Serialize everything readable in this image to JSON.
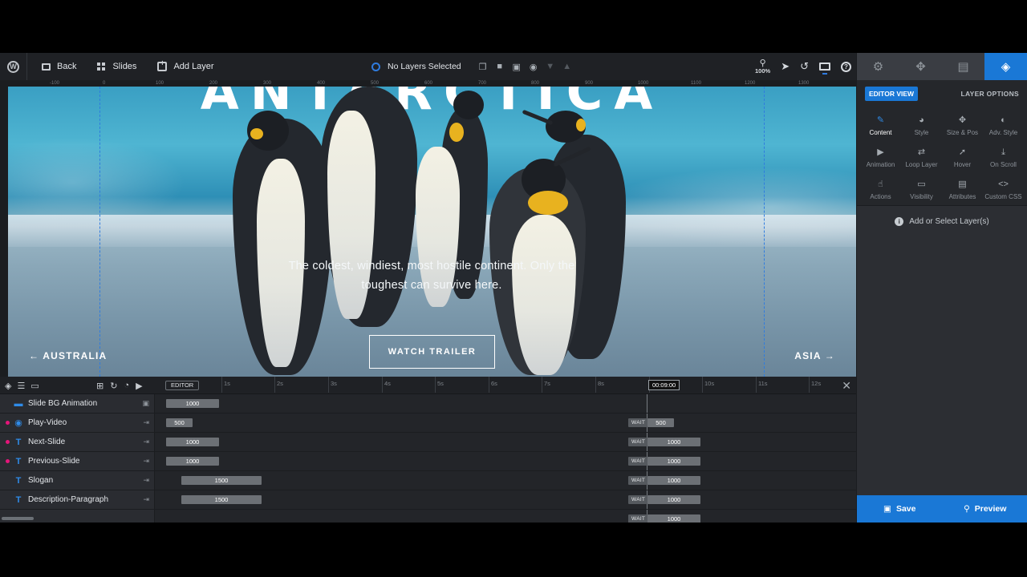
{
  "toolbar": {
    "back_label": "Back",
    "slides_label": "Slides",
    "add_layer_label": "Add Layer",
    "layer_status": "No Layers Selected",
    "zoom_level": "100%"
  },
  "ruler": {
    "marks": [
      "-100",
      "0",
      "100",
      "200",
      "300",
      "400",
      "500",
      "600",
      "700",
      "800",
      "900",
      "1000",
      "1100",
      "1200",
      "1300"
    ]
  },
  "slide": {
    "title": "ANTARCTICA",
    "paragraph": "The coldest, windiest, most hostile continent. Only the toughest can survive here.",
    "button_label": "WATCH TRAILER",
    "prev_label": "← AUSTRALIA",
    "next_label": "ASIA →"
  },
  "panel": {
    "tabs": [
      "gear-icon",
      "puzzle-icon",
      "slides-icon",
      "layers-icon"
    ],
    "editor_view_label": "EDITOR VIEW",
    "layer_options_label": "LAYER OPTIONS",
    "options": [
      {
        "label": "Content",
        "icon": "pencil-icon",
        "active": true
      },
      {
        "label": "Style",
        "icon": "palette-icon"
      },
      {
        "label": "Size & Pos",
        "icon": "move-icon"
      },
      {
        "label": "Adv. Style",
        "icon": "contrast-icon"
      },
      {
        "label": "Animation",
        "icon": "play-icon"
      },
      {
        "label": "Loop Layer",
        "icon": "loop-icon"
      },
      {
        "label": "Hover",
        "icon": "pointer-icon"
      },
      {
        "label": "On Scroll",
        "icon": "scroll-icon"
      },
      {
        "label": "Actions",
        "icon": "hand-icon"
      },
      {
        "label": "Visibility",
        "icon": "visibility-icon"
      },
      {
        "label": "Attributes",
        "icon": "file-icon"
      },
      {
        "label": "Custom CSS",
        "icon": "code-icon"
      }
    ],
    "empty_message": "Add or Select Layer(s)",
    "save_label": "Save",
    "preview_label": "Preview"
  },
  "timeline": {
    "editor_label": "EDITOR",
    "ticks": [
      "1s",
      "2s",
      "3s",
      "4s",
      "5s",
      "6s",
      "7s",
      "8s",
      "9s",
      "10s",
      "11s",
      "12s"
    ],
    "current_time": "00:09:00",
    "wait_label": "WAIT",
    "rows": [
      {
        "name": "Slide BG Animation",
        "type": "slide",
        "start": 1000
      },
      {
        "name": "Play-Video",
        "type": "video",
        "dot": true,
        "start": 500,
        "end": 500
      },
      {
        "name": "Next-Slide",
        "type": "text",
        "dot": true,
        "start": 1000,
        "end": 1000
      },
      {
        "name": "Previous-Slide",
        "type": "text",
        "dot": true,
        "start": 1000,
        "end": 1000
      },
      {
        "name": "Slogan",
        "type": "text",
        "start": 1500,
        "end": 1000
      },
      {
        "name": "Description-Paragraph",
        "type": "text",
        "start": 1500,
        "end": 1000
      },
      {
        "name": "",
        "type": "text",
        "end": 1000
      }
    ]
  }
}
